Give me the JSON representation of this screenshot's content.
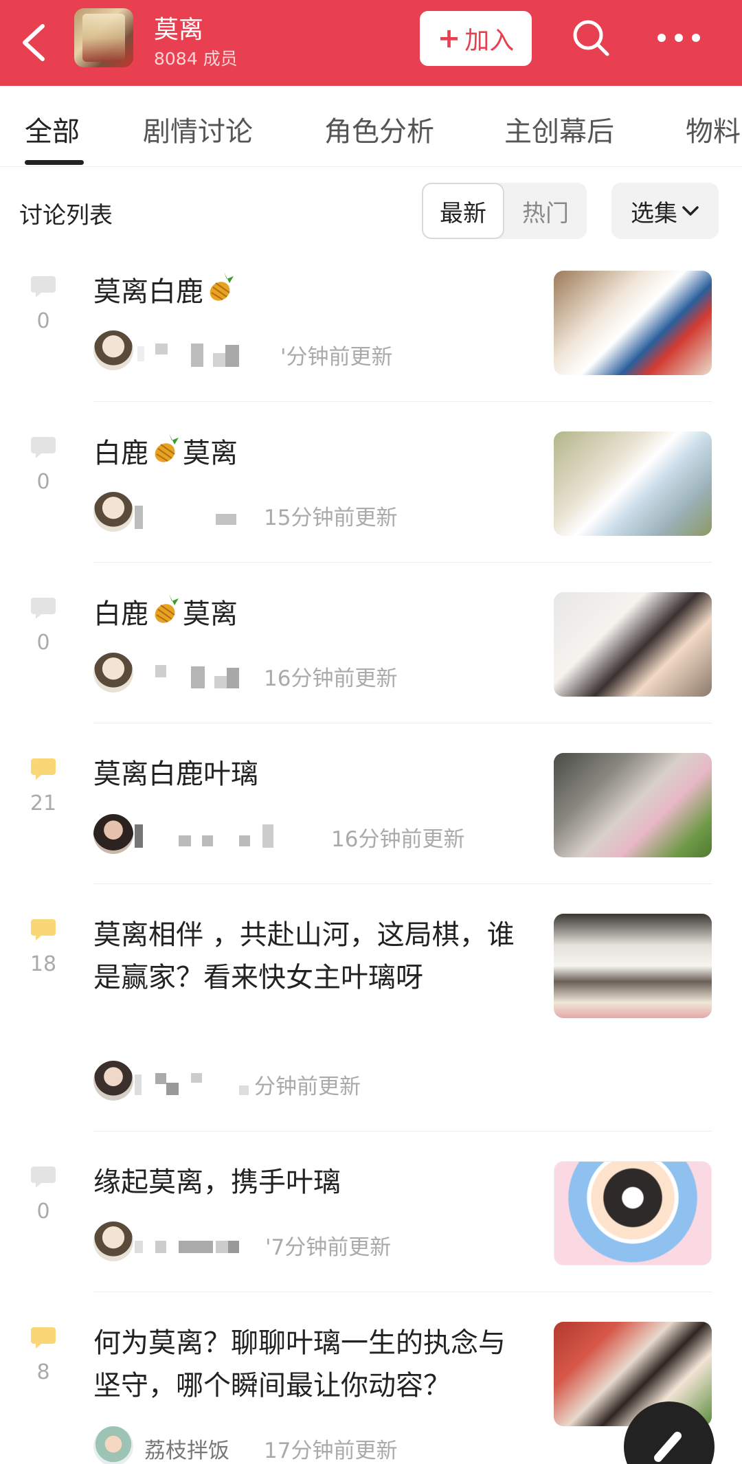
{
  "header": {
    "group_name": "莫离",
    "members": "8084 成员",
    "join_label": "加入",
    "join_icon": "+",
    "icons": [
      "back-arrow-icon",
      "search-icon",
      "more-icon"
    ],
    "brand_color": "#e84051"
  },
  "tabs": [
    {
      "label": "全部",
      "active": true
    },
    {
      "label": "剧情讨论",
      "active": false
    },
    {
      "label": "角色分析",
      "active": false
    },
    {
      "label": "主创幕后",
      "active": false
    },
    {
      "label": "物料",
      "active": false
    }
  ],
  "list": {
    "title": "讨论列表",
    "sort": {
      "latest": "最新",
      "hot": "热门",
      "selected": "最新"
    },
    "episode_label": "选集"
  },
  "items": [
    {
      "title_pre": "莫离白鹿",
      "title_post": "",
      "pineapple": true,
      "count": "0",
      "time": "'分钟前更新",
      "comment_color": "#e3e3e3"
    },
    {
      "title_pre": "白鹿",
      "title_post": "莫离",
      "pineapple": true,
      "count": "0",
      "time": "15分钟前更新",
      "comment_color": "#e3e3e3"
    },
    {
      "title_pre": "白鹿",
      "title_post": "莫离",
      "pineapple": true,
      "count": "0",
      "time": "16分钟前更新",
      "comment_color": "#e3e3e3"
    },
    {
      "title_pre": "莫离白鹿叶璃",
      "title_post": "",
      "pineapple": false,
      "count": "21",
      "time": "16分钟前更新",
      "comment_color": "#f9d777"
    },
    {
      "title_pre": "莫离相伴 ，共赴山河，这局棋，谁是赢家？看来快女主叶璃呀",
      "title_post": "",
      "pineapple": false,
      "count": "18",
      "time": "分钟前更新",
      "comment_color": "#f9d777"
    },
    {
      "title_pre": "缘起莫离，携手叶璃",
      "title_post": "",
      "pineapple": false,
      "count": "0",
      "time": "'7分钟前更新",
      "comment_color": "#e3e3e3"
    },
    {
      "title_pre": "何为莫离？聊聊叶璃一生的执念与坚守，哪个瞬间最让你动容？",
      "title_post": "",
      "pineapple": false,
      "count": "8",
      "time": "17分钟前更新",
      "author": "荔枝拌饭",
      "comment_color": "#f9d777"
    }
  ]
}
